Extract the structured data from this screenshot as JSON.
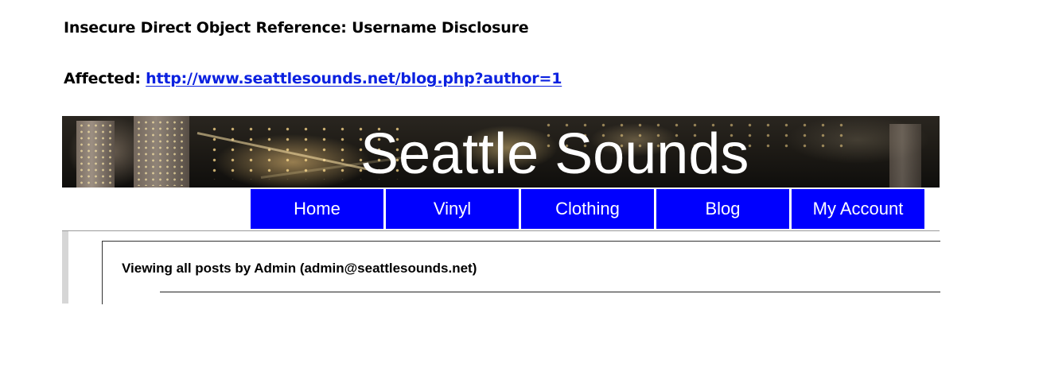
{
  "document": {
    "heading": "Insecure Direct Object Reference: Username Disclosure",
    "affected_label": "Affected: ",
    "affected_url": "http://www.seattlesounds.net/blog.php?author=1"
  },
  "site": {
    "title": "Seattle Sounds",
    "nav": [
      {
        "label": "Home"
      },
      {
        "label": "Vinyl"
      },
      {
        "label": "Clothing"
      },
      {
        "label": "Blog"
      },
      {
        "label": "My Account"
      }
    ],
    "viewing_text": "Viewing all posts by Admin (admin@seattlesounds.net)"
  },
  "colors": {
    "nav_background": "#0000ff",
    "link": "#0b21e0"
  }
}
